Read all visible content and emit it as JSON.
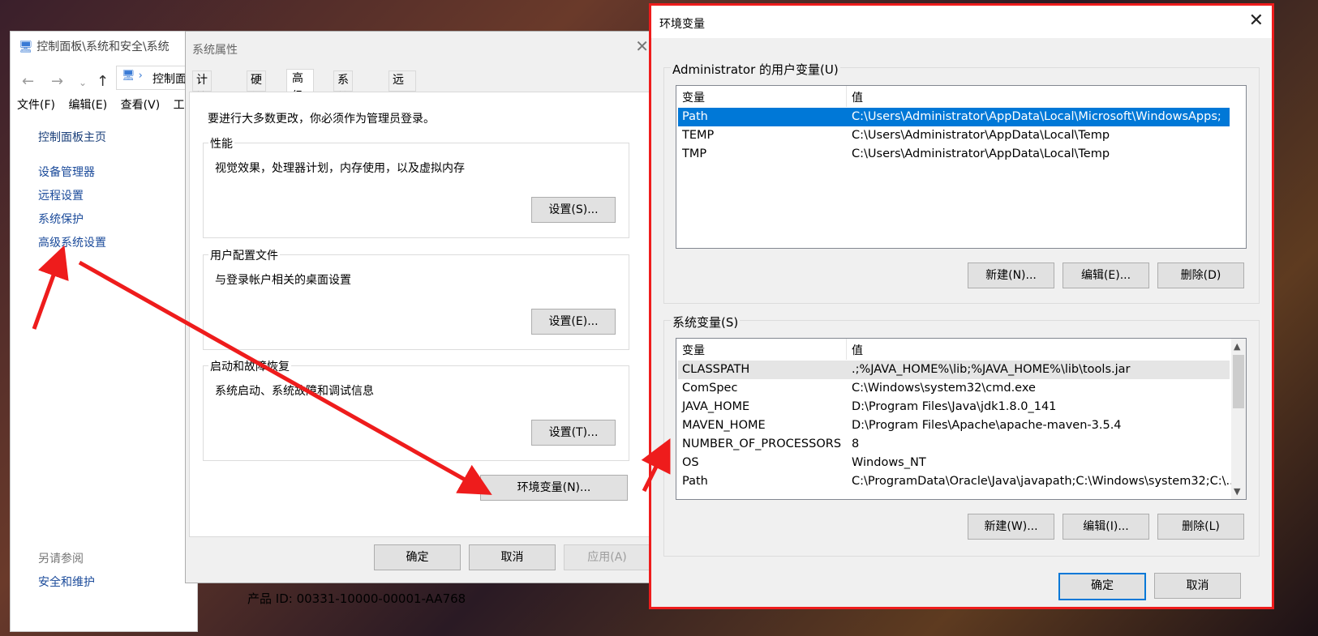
{
  "control_panel": {
    "title": "控制面板\\系统和安全\\系统",
    "address": "控制面",
    "menu": [
      "文件(F)",
      "编辑(E)",
      "查看(V)",
      "工"
    ],
    "links": [
      "控制面板主页",
      "设备管理器",
      "远程设置",
      "系统保护",
      "高级系统设置"
    ],
    "see_also": "另请参阅",
    "see_also_link": "安全和维护"
  },
  "system_properties": {
    "title": "系统属性",
    "tabs": [
      "计算机名",
      "硬件",
      "高级",
      "系统保护",
      "远程"
    ],
    "admin_note": "要进行大多数更改，你必须作为管理员登录。",
    "performance": {
      "label": "性能",
      "desc": "视觉效果，处理器计划，内存使用，以及虚拟内存",
      "button": "设置(S)..."
    },
    "profiles": {
      "label": "用户配置文件",
      "desc": "与登录帐户相关的桌面设置",
      "button": "设置(E)..."
    },
    "startup": {
      "label": "启动和故障恢复",
      "desc": "系统启动、系统故障和调试信息",
      "button": "设置(T)..."
    },
    "env_button": "环境变量(N)...",
    "ok": "确定",
    "cancel": "取消",
    "apply": "应用(A)",
    "product_id": "产品 ID: 00331-10000-00001-AA768"
  },
  "env_vars": {
    "title": "环境变量",
    "user_group": "Administrator 的用户变量(U)",
    "col_var": "变量",
    "col_val": "值",
    "user_rows": [
      {
        "name": "Path",
        "value": "C:\\Users\\Administrator\\AppData\\Local\\Microsoft\\WindowsApps;"
      },
      {
        "name": "TEMP",
        "value": "C:\\Users\\Administrator\\AppData\\Local\\Temp"
      },
      {
        "name": "TMP",
        "value": "C:\\Users\\Administrator\\AppData\\Local\\Temp"
      }
    ],
    "user_buttons": [
      "新建(N)...",
      "编辑(E)...",
      "删除(D)"
    ],
    "system_group": "系统变量(S)",
    "system_rows": [
      {
        "name": "CLASSPATH",
        "value": ".;%JAVA_HOME%\\lib;%JAVA_HOME%\\lib\\tools.jar"
      },
      {
        "name": "ComSpec",
        "value": "C:\\Windows\\system32\\cmd.exe"
      },
      {
        "name": "JAVA_HOME",
        "value": "D:\\Program Files\\Java\\jdk1.8.0_141"
      },
      {
        "name": "MAVEN_HOME",
        "value": "D:\\Program Files\\Apache\\apache-maven-3.5.4"
      },
      {
        "name": "NUMBER_OF_PROCESSORS",
        "value": "8"
      },
      {
        "name": "OS",
        "value": "Windows_NT"
      },
      {
        "name": "Path",
        "value": "C:\\ProgramData\\Oracle\\Java\\javapath;C:\\Windows\\system32;C:\\..."
      }
    ],
    "system_buttons": [
      "新建(W)...",
      "编辑(I)...",
      "删除(L)"
    ],
    "ok": "确定",
    "cancel": "取消"
  },
  "colors": {
    "highlight": "#0078d7",
    "annotation": "#ee1c1c"
  }
}
